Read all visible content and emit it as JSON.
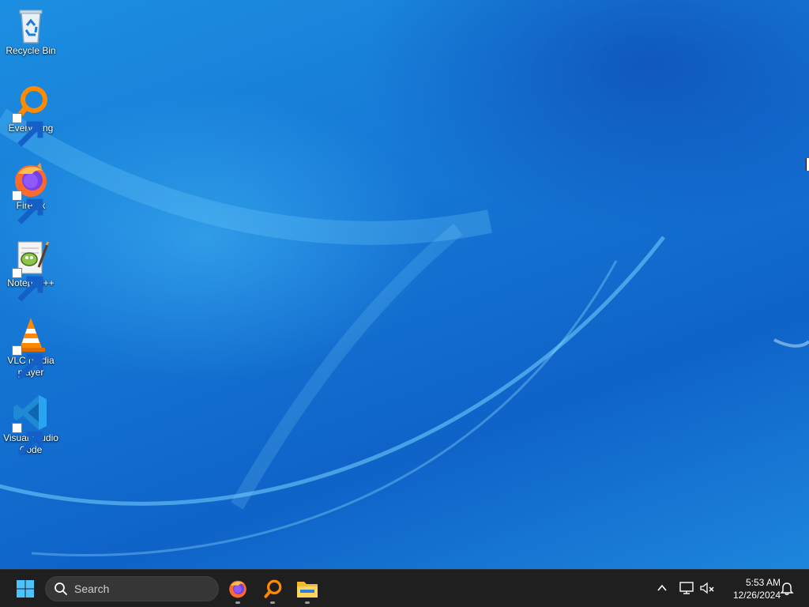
{
  "desktop": {
    "icons": [
      {
        "label": "Recycle Bin",
        "icon": "recycle-bin-icon",
        "shortcut": false
      },
      {
        "label": "Everything",
        "icon": "everything-icon",
        "shortcut": true
      },
      {
        "label": "Firefox",
        "icon": "firefox-icon",
        "shortcut": true
      },
      {
        "label": "Notepad++",
        "icon": "notepadpp-icon",
        "shortcut": true
      },
      {
        "label": "VLC media player",
        "icon": "vlc-icon",
        "shortcut": true
      },
      {
        "label": "Visual Studio Code",
        "icon": "vscode-icon",
        "shortcut": true
      }
    ]
  },
  "taskbar": {
    "start_icon": "windows-logo-icon",
    "search": {
      "placeholder": "Search",
      "icon": "search-icon"
    },
    "pinned_apps": [
      {
        "name": "Firefox",
        "icon": "firefox-icon",
        "running": true
      },
      {
        "name": "Everything",
        "icon": "everything-icon",
        "running": true
      },
      {
        "name": "File Explorer",
        "icon": "folder-icon",
        "running": true
      }
    ],
    "tray": {
      "overflow_icon": "chevron-up-icon",
      "network_icon": "network-icon",
      "volume_icon": "volume-muted-icon",
      "notification_icon": "bell-icon"
    },
    "clock": {
      "time": "5:53 AM",
      "date": "12/26/2024"
    }
  },
  "colors": {
    "desktop_blue": "#1679d6",
    "taskbar_bg": "#1f1f1f",
    "search_bg": "#363636"
  }
}
